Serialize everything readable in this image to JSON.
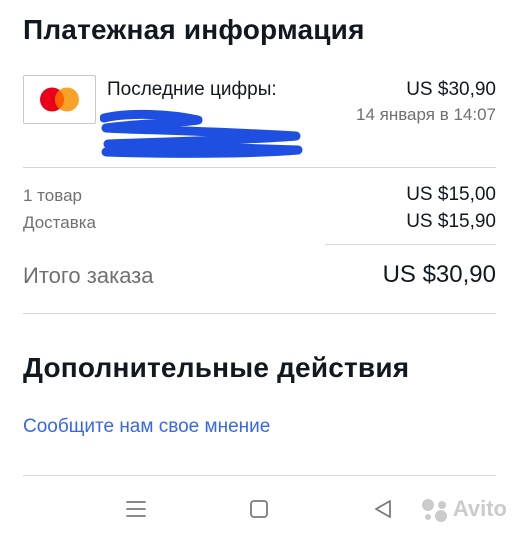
{
  "payment": {
    "title": "Платежная информация",
    "last_digits_label": "Последние цифры:",
    "amount": "US $30,90",
    "date": "14 января в 14:07",
    "card_icon": "mastercard-logo"
  },
  "summary": {
    "items_label": "1 товар",
    "items_value": "US $15,00",
    "shipping_label": "Доставка",
    "shipping_value": "US $15,90",
    "total_label": "Итого заказа",
    "total_value": "US $30,90"
  },
  "actions": {
    "title": "Дополнительные действия",
    "feedback_link": "Сообщите нам свое мнение"
  },
  "navbar": {
    "menu_icon": "menu-icon",
    "home_icon": "home-icon",
    "back_icon": "back-icon"
  },
  "watermark": {
    "text": "Avito"
  },
  "colors": {
    "link": "#3665f3",
    "text": "#111820",
    "muted": "#707070",
    "redaction": "#1e4fe0",
    "mastercard_red": "#eb001b",
    "mastercard_orange": "#f79e1b"
  }
}
